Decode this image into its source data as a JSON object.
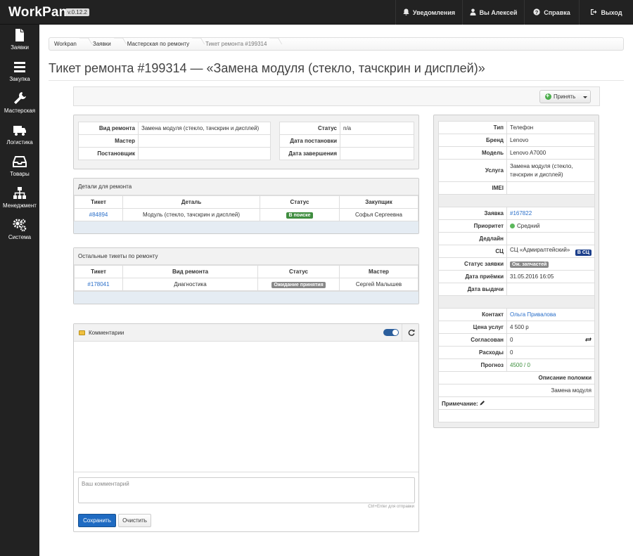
{
  "app": {
    "name": "WorkPan",
    "version": "v.0.12.2"
  },
  "topnav": {
    "notifications": "Уведомления",
    "user": "Вы Алексей",
    "help": "Справка",
    "logout": "Выход"
  },
  "sidebar": {
    "items": [
      {
        "label": "Заявки",
        "icon": "file-icon"
      },
      {
        "label": "Закупка",
        "icon": "list-icon"
      },
      {
        "label": "Мастерская",
        "icon": "wrench-icon"
      },
      {
        "label": "Логистика",
        "icon": "truck-icon"
      },
      {
        "label": "Товары",
        "icon": "inbox-icon"
      },
      {
        "label": "Менеджмент",
        "icon": "sitemap-icon"
      },
      {
        "label": "Система",
        "icon": "gears-icon"
      }
    ]
  },
  "breadcrumb": [
    "Workpan",
    "Заявки",
    "Мастерская по ремонту",
    "Тикет ремонта #199314"
  ],
  "page_title": "Тикет ремонта #199314 — «Замена модуля (стекло, тачскрин и дисплей)»",
  "toolbar": {
    "accept_label": "Принять"
  },
  "info": {
    "left": [
      {
        "key": "Вид ремонта",
        "value": "Замена модуля (стекло, тачскрин и дисплей)"
      },
      {
        "key": "Мастер",
        "value": ""
      },
      {
        "key": "Постановщик",
        "value": ""
      }
    ],
    "right": [
      {
        "key": "Статус",
        "value": "n/a"
      },
      {
        "key": "Дата постановки",
        "value": ""
      },
      {
        "key": "Дата завершения",
        "value": ""
      }
    ]
  },
  "parts": {
    "title": "Детали для ремонта",
    "columns": [
      "Тикет",
      "Деталь",
      "Статус",
      "Закупщик"
    ],
    "rows": [
      {
        "ticket": "#84894",
        "part": "Модуль (стекло, тачскрин и дисплей)",
        "status": "В поиске",
        "buyer": "Софья Сергеевна"
      }
    ]
  },
  "other_tickets": {
    "title": "Остальные тикеты по ремонту",
    "columns": [
      "Тикет",
      "Вид ремонта",
      "Статус",
      "Мастер"
    ],
    "rows": [
      {
        "ticket": "#178041",
        "repair": "Диагностика",
        "status": "Ожидание принятия",
        "master": "Сергей Малышев"
      }
    ]
  },
  "comments": {
    "title": "Комментарии",
    "placeholder": "Ваш комментарий",
    "hint": "Ctrl+Enter для отправки",
    "save_label": "Сохранить",
    "clear_label": "Очистить"
  },
  "details": {
    "type": {
      "key": "Тип",
      "value": "Телефон"
    },
    "brand": {
      "key": "Бренд",
      "value": "Lenovo"
    },
    "model": {
      "key": "Модель",
      "value": "Lenovo A7000"
    },
    "service": {
      "key": "Услуга",
      "value": "Замена модуля (стекло, тачскрин и дисплей)"
    },
    "imei": {
      "key": "IMEI",
      "value": ""
    },
    "order": {
      "key": "Заявка",
      "value": "#167822"
    },
    "priority": {
      "key": "Приоритет",
      "value": "Средний"
    },
    "deadline": {
      "key": "Дедлайн",
      "value": ""
    },
    "sc": {
      "key": "СЦ",
      "value": "СЦ «Адмиралтейский»",
      "badge": "В СЦ"
    },
    "order_status": {
      "key": "Статус заявки",
      "value": "Ож. запчастей"
    },
    "accepted_date": {
      "key": "Дата приёмки",
      "value": "31.05.2016 16:05"
    },
    "issue_date": {
      "key": "Дата выдачи",
      "value": ""
    },
    "contact": {
      "key": "Контакт",
      "value": "Ольга Привалова"
    },
    "price": {
      "key": "Цена услуг",
      "value": "4 500 р"
    },
    "agreed": {
      "key": "Согласован",
      "value": "0"
    },
    "expenses": {
      "key": "Расходы",
      "value": "0"
    },
    "forecast": {
      "key": "Прогноз",
      "value": "4500 / 0"
    },
    "breakdown_header": "Описание поломки",
    "breakdown_value": "Замена модуля",
    "note_label": "Примечание:"
  },
  "colors": {
    "topbar": "#222222",
    "link": "#2a6fc9",
    "primary_button": "#1f6bc2",
    "status_green": "#3f8d3f"
  }
}
